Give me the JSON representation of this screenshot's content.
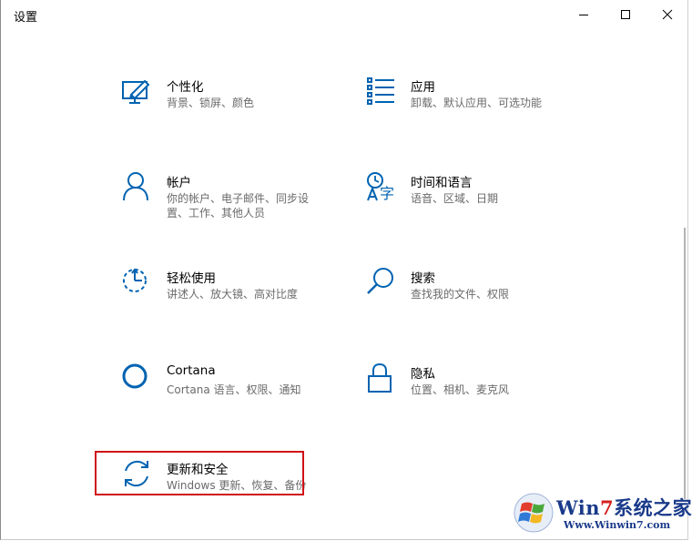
{
  "window": {
    "title": "设置"
  },
  "tiles": [
    {
      "name": "个性化",
      "desc": "背景、锁屏、颜色",
      "icon": "personalization-icon"
    },
    {
      "name": "应用",
      "desc": "卸载、默认应用、可选功能",
      "icon": "apps-icon"
    },
    {
      "name": "帐户",
      "desc": "你的帐户、电子邮件、同步设置、工作、其他人员",
      "icon": "account-icon"
    },
    {
      "name": "时间和语言",
      "desc": "语音、区域、日期",
      "icon": "time-language-icon"
    },
    {
      "name": "轻松使用",
      "desc": "讲述人、放大镜、高对比度",
      "icon": "ease-of-access-icon"
    },
    {
      "name": "搜索",
      "desc": "查找我的文件、权限",
      "icon": "search-icon"
    },
    {
      "name": "Cortana",
      "desc": "Cortana 语言、权限、通知",
      "icon": "cortana-icon"
    },
    {
      "name": "隐私",
      "desc": "位置、相机、麦克风",
      "icon": "privacy-lock-icon"
    },
    {
      "name": "更新和安全",
      "desc": "Windows 更新、恢复、备份",
      "icon": "update-sync-icon"
    }
  ],
  "watermark": {
    "line1_a": "Win",
    "line1_b": "7",
    "line1_c": "系统之家",
    "line2": "Www.Winwin7.com"
  },
  "colors": {
    "accent": "#0063b1",
    "highlight": "#d01016"
  }
}
